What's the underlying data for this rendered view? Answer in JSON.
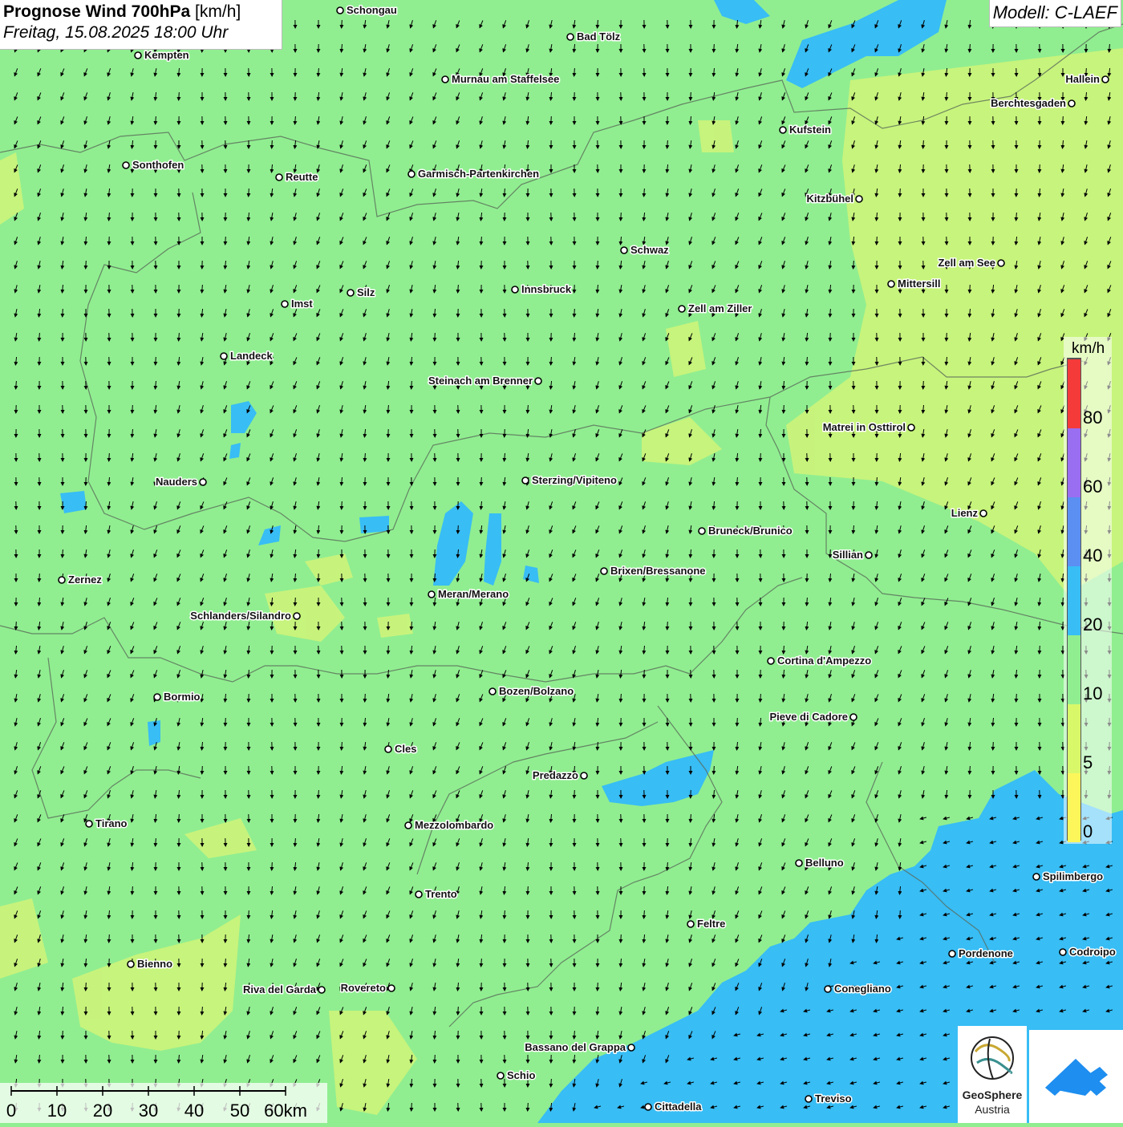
{
  "header": {
    "title": "Prognose Wind 700hPa",
    "unit": "[km/h]",
    "datetime": "Freitag, 15.08.2025 18:00 Uhr"
  },
  "model": "Modell: C-LAEF",
  "legend": {
    "unit": "km/h",
    "ticks": [
      "0",
      "5",
      "10",
      "20",
      "40",
      "60",
      "80"
    ],
    "class_colors": [
      "#fdf65a",
      "#d8f869",
      "#90ee90",
      "#38bdf5",
      "#5b8ff2",
      "#9a6ef0",
      "#f53a3a"
    ]
  },
  "scale_bar": {
    "labels": [
      "0",
      "10",
      "20",
      "30",
      "40",
      "50",
      "60km"
    ]
  },
  "logos": {
    "geosphere_line1": "GeoSphere",
    "geosphere_line2": "Austria"
  },
  "cities": [
    {
      "name": "Schongau",
      "side": "r"
    },
    {
      "name": "Bad Tölz",
      "side": "r"
    },
    {
      "name": "Kempten",
      "side": "r"
    },
    {
      "name": "Murnau am Staffelsee",
      "side": "r"
    },
    {
      "name": "Hallein",
      "side": "l"
    },
    {
      "name": "Berchtesgaden",
      "side": "l"
    },
    {
      "name": "Kufstein",
      "side": "r"
    },
    {
      "name": "Sonthofen",
      "side": "r"
    },
    {
      "name": "Reutte",
      "side": "r"
    },
    {
      "name": "Garmisch-Partenkirchen",
      "side": "r"
    },
    {
      "name": "Kitzbühel",
      "side": "l"
    },
    {
      "name": "Schwaz",
      "side": "r"
    },
    {
      "name": "Zell am See",
      "side": "l"
    },
    {
      "name": "Mittersill",
      "side": "r"
    },
    {
      "name": "Silz",
      "side": "r"
    },
    {
      "name": "Innsbruck",
      "side": "r"
    },
    {
      "name": "Imst",
      "side": "r"
    },
    {
      "name": "Zell am Ziller",
      "side": "r"
    },
    {
      "name": "Landeck",
      "side": "r"
    },
    {
      "name": "Steinach am Brenner",
      "side": "l"
    },
    {
      "name": "Matrei in Osttirol",
      "side": "l"
    },
    {
      "name": "Nauders",
      "side": "l"
    },
    {
      "name": "Sterzing/Vipiteno",
      "side": "r"
    },
    {
      "name": "Lienz",
      "side": "l"
    },
    {
      "name": "Bruneck/Brunico",
      "side": "r"
    },
    {
      "name": "Sillian",
      "side": "l"
    },
    {
      "name": "Brixen/Bressanone",
      "side": "r"
    },
    {
      "name": "Zernez",
      "side": "r"
    },
    {
      "name": "Meran/Merano",
      "side": "r"
    },
    {
      "name": "Schlanders/Silandro",
      "side": "l"
    },
    {
      "name": "Cortina d'Ampezzo",
      "side": "r"
    },
    {
      "name": "Bozen/Bolzano",
      "side": "r"
    },
    {
      "name": "Bormio",
      "side": "r"
    },
    {
      "name": "Pieve di Cadore",
      "side": "l"
    },
    {
      "name": "Cles",
      "side": "r"
    },
    {
      "name": "Predazzo",
      "side": "l"
    },
    {
      "name": "Tirano",
      "side": "r"
    },
    {
      "name": "Mezzolombardo",
      "side": "r"
    },
    {
      "name": "Belluno",
      "side": "r"
    },
    {
      "name": "Spilimbergo",
      "side": "r"
    },
    {
      "name": "Trento",
      "side": "r"
    },
    {
      "name": "Feltre",
      "side": "r"
    },
    {
      "name": "Pordenone",
      "side": "r"
    },
    {
      "name": "Codroipo",
      "side": "r"
    },
    {
      "name": "Bienno",
      "side": "r"
    },
    {
      "name": "Riva del Garda",
      "side": "l"
    },
    {
      "name": "Rovereto",
      "side": "l"
    },
    {
      "name": "Conegliano",
      "side": "r"
    },
    {
      "name": "Bassano del Grappa",
      "side": "l"
    },
    {
      "name": "Schio",
      "side": "r"
    },
    {
      "name": "Treviso",
      "side": "r"
    },
    {
      "name": "Cittadella",
      "side": "r"
    }
  ]
}
